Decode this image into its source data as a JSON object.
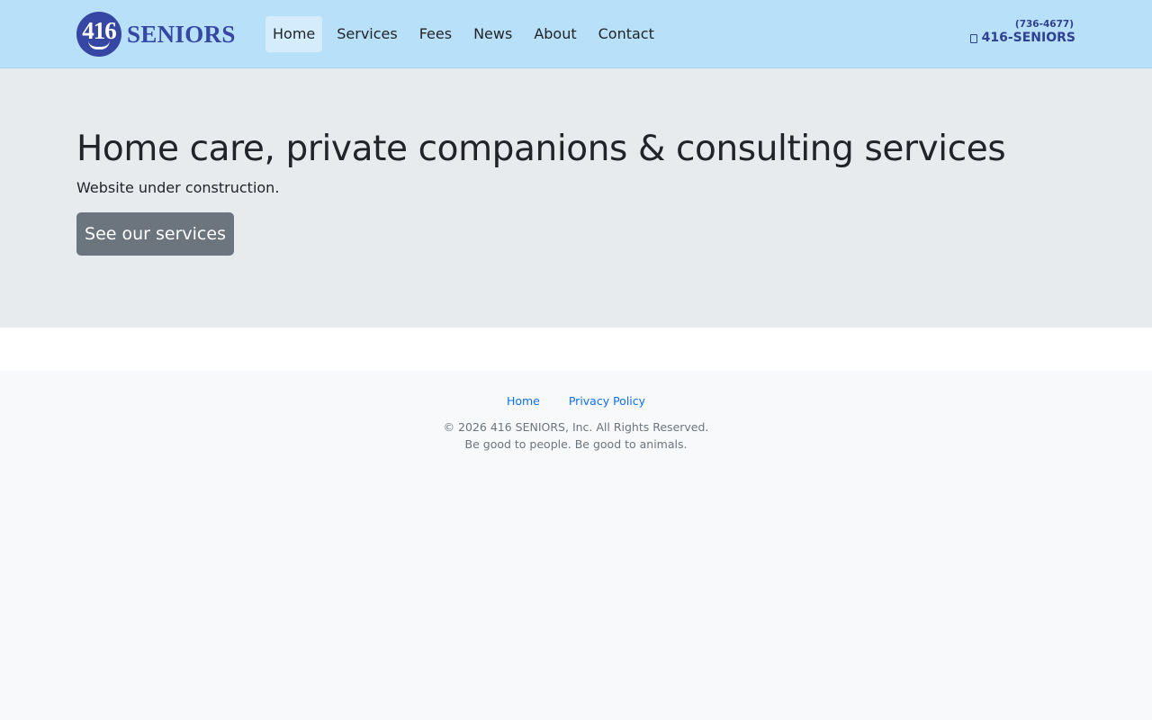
{
  "header": {
    "brand": {
      "number": "416",
      "word": "SENIORS"
    },
    "nav": [
      {
        "label": "Home",
        "active": true
      },
      {
        "label": "Services",
        "active": false
      },
      {
        "label": "Fees",
        "active": false
      },
      {
        "label": "News",
        "active": false
      },
      {
        "label": "About",
        "active": false
      },
      {
        "label": "Contact",
        "active": false
      }
    ],
    "phone": {
      "digits": "(736-4677)",
      "vanity": "416-SENIORS",
      "icon": "phone-icon"
    }
  },
  "hero": {
    "title": "Home care, private companions & consulting services",
    "lead": "Website under construction.",
    "button_label": "See our services"
  },
  "footer": {
    "links": [
      "Home",
      "Privacy Policy"
    ],
    "copyright": "© 2026 416 SENIORS, Inc. All Rights Reserved.",
    "tagline": "Be good to people. Be good to animals."
  },
  "colors": {
    "navbar_bg": "#b8e0f9",
    "brand_blue": "#3547a3",
    "hero_bg": "#e8ebee",
    "button_bg": "#6c757d",
    "link_blue": "#0d6efd",
    "footer_bg": "#f8f9fa"
  }
}
